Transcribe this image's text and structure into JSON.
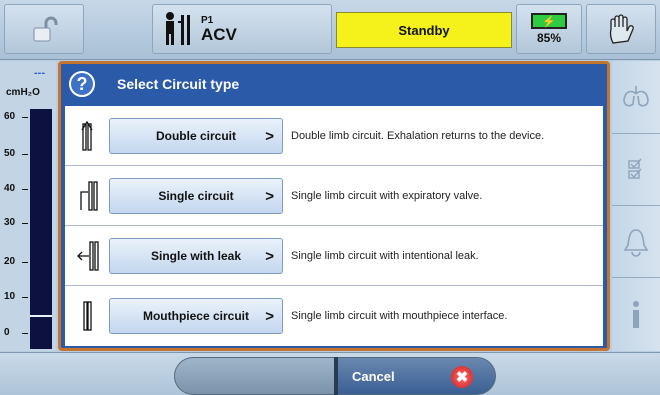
{
  "topbar": {
    "mode_prefix": "P1",
    "mode": "ACV",
    "status": "Standby",
    "battery_percent": "85%"
  },
  "gauge": {
    "dash": "---",
    "unit": "cmH₂O",
    "ticks": [
      "60",
      "50",
      "40",
      "30",
      "20",
      "10",
      "0"
    ]
  },
  "dialog": {
    "title": "Select Circuit type",
    "rows": [
      {
        "label": "Double circuit",
        "description": "Double limb circuit. Exhalation returns to the device."
      },
      {
        "label": "Single circuit",
        "description": "Single limb circuit with expiratory valve."
      },
      {
        "label": "Single with leak",
        "description": "Single limb circuit with intentional leak."
      },
      {
        "label": "Mouthpiece circuit",
        "description": "Single limb circuit with mouthpiece interface."
      }
    ]
  },
  "bottombar": {
    "cancel_label": "Cancel"
  },
  "icons": {
    "lock": "unlock-icon",
    "patient": "patient-icon",
    "battery": "battery-charging-icon",
    "alarm_silence": "hand-icon",
    "help": "question-icon",
    "lungs": "lungs-icon",
    "checklist": "checklist-icon",
    "alarm": "bell-icon",
    "info": "info-icon",
    "cancel": "close-icon"
  },
  "colors": {
    "dialog_bg": "#2b5aa8",
    "standby_bg": "#f4f21a",
    "dialog_border": "#c4742c"
  }
}
